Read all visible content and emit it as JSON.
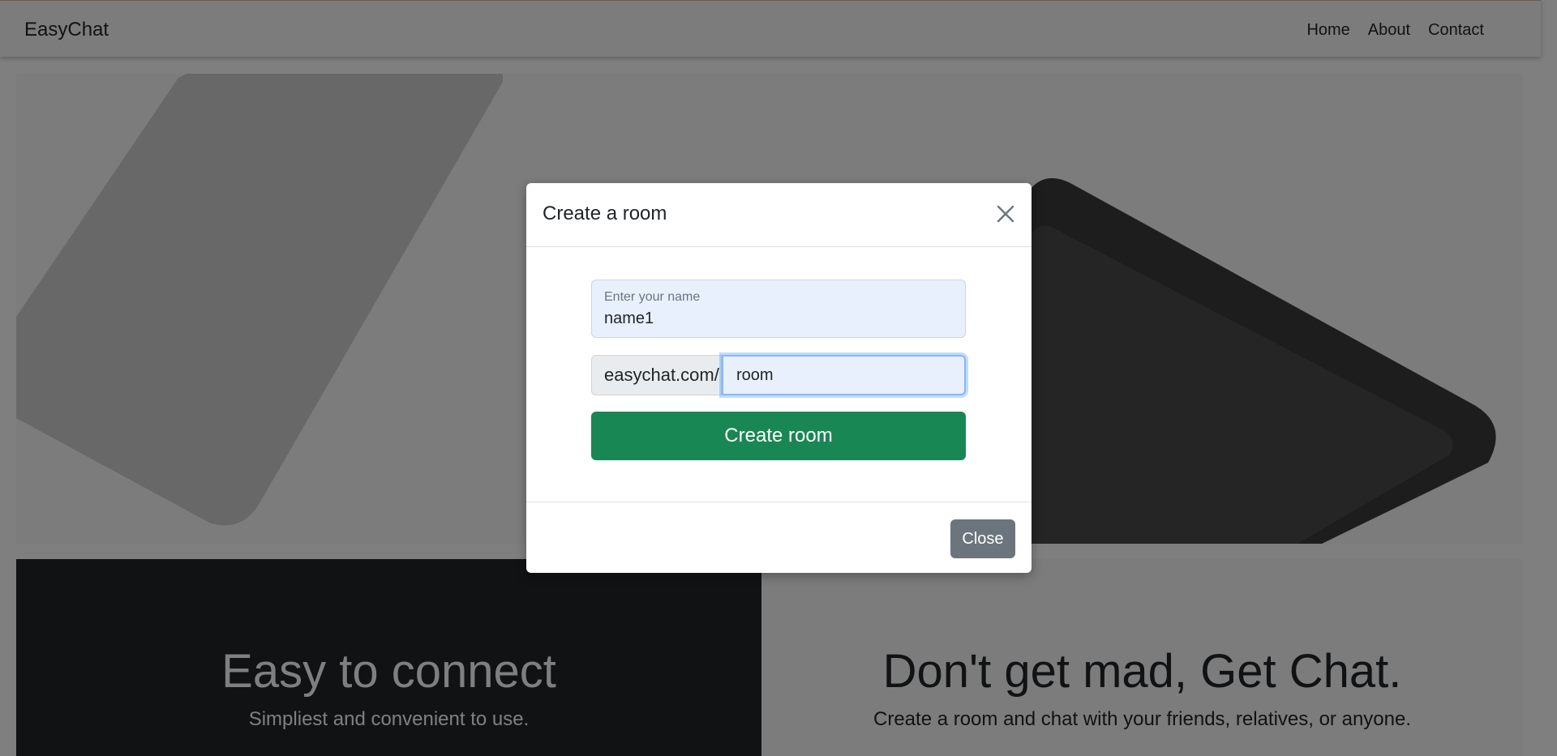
{
  "navbar": {
    "brand": "EasyChat",
    "links": [
      "Home",
      "About",
      "Contact"
    ]
  },
  "features": [
    {
      "heading": "Easy to connect",
      "subtitle": "Simpliest and convenient to use."
    },
    {
      "heading": "Don't get mad, Get Chat.",
      "subtitle": "Create a room and chat with your friends, relatives, or anyone."
    }
  ],
  "modal": {
    "title": "Create a room",
    "name_field": {
      "label": "Enter your name",
      "value": "name1"
    },
    "room_prefix": "easychat.com/",
    "room_value": "room",
    "create_label": "Create room",
    "close_label": "Close"
  },
  "colors": {
    "success": "#198754",
    "secondary": "#6c757d",
    "dark": "#212529",
    "light": "#f8f9fa"
  },
  "icons": {
    "close": "close-x-icon"
  }
}
